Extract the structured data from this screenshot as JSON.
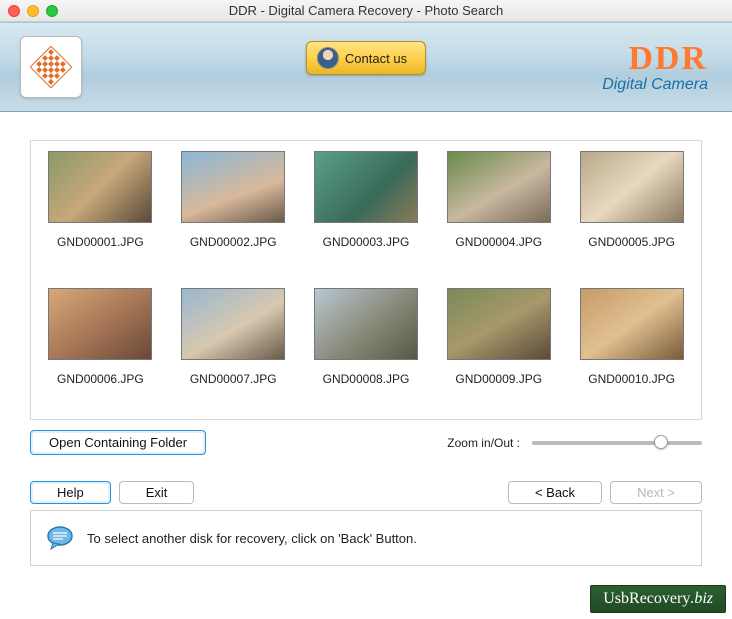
{
  "titlebar": {
    "title": "DDR - Digital Camera Recovery - Photo Search"
  },
  "banner": {
    "contact_label": "Contact us",
    "brand_main": "DDR",
    "brand_sub": "Digital Camera"
  },
  "thumbnails": [
    {
      "filename": "GND00001.JPG",
      "class": "p1"
    },
    {
      "filename": "GND00002.JPG",
      "class": "p2"
    },
    {
      "filename": "GND00003.JPG",
      "class": "p3"
    },
    {
      "filename": "GND00004.JPG",
      "class": "p4"
    },
    {
      "filename": "GND00005.JPG",
      "class": "p5"
    },
    {
      "filename": "GND00006.JPG",
      "class": "p6"
    },
    {
      "filename": "GND00007.JPG",
      "class": "p7"
    },
    {
      "filename": "GND00008.JPG",
      "class": "p8"
    },
    {
      "filename": "GND00009.JPG",
      "class": "p9"
    },
    {
      "filename": "GND00010.JPG",
      "class": "p10"
    }
  ],
  "controls": {
    "open_folder_label": "Open Containing Folder",
    "zoom_label": "Zoom in/Out :",
    "zoom_value": 72
  },
  "buttons": {
    "help": "Help",
    "exit": "Exit",
    "back": "< Back",
    "next": "Next >"
  },
  "hint": {
    "text": "To select another disk for recovery, click on 'Back' Button."
  },
  "watermark": {
    "main": "UsbRecovery",
    "suffix": ".biz"
  }
}
